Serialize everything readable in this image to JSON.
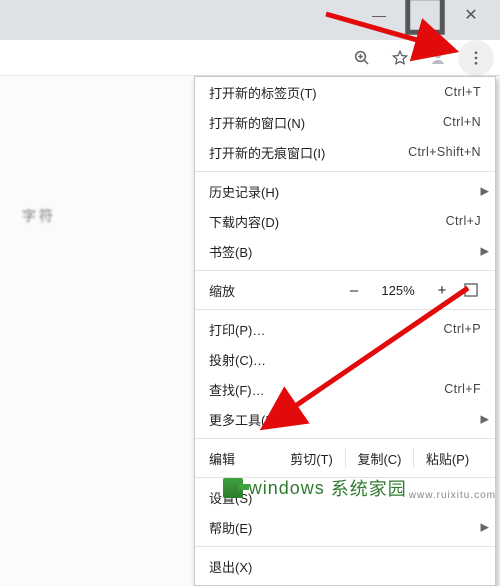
{
  "window_controls": {
    "minimize_glyph": "—",
    "maximize_glyph": "◻",
    "close_glyph": "✕"
  },
  "toolbar": {
    "zoom_icon": "zoom",
    "star_icon": "star",
    "profile_icon": "profile",
    "kebab_icon": "kebab"
  },
  "blur_left_text": "字符",
  "menu": {
    "new_tab": {
      "label": "打开新的标签页(T)",
      "accel": "Ctrl+T"
    },
    "new_window": {
      "label": "打开新的窗口(N)",
      "accel": "Ctrl+N"
    },
    "incognito": {
      "label": "打开新的无痕窗口(I)",
      "accel": "Ctrl+Shift+N"
    },
    "history": {
      "label": "历史记录(H)"
    },
    "downloads": {
      "label": "下载内容(D)",
      "accel": "Ctrl+J"
    },
    "bookmarks": {
      "label": "书签(B)"
    },
    "zoom": {
      "label": "缩放",
      "minus": "–",
      "value": "125%",
      "plus": "+"
    },
    "print": {
      "label": "打印(P)…",
      "accel": "Ctrl+P"
    },
    "cast": {
      "label": "投射(C)…"
    },
    "find": {
      "label": "查找(F)…",
      "accel": "Ctrl+F"
    },
    "more_tools": {
      "label": "更多工具(L)"
    },
    "edit": {
      "label": "编辑",
      "cut": "剪切(T)",
      "copy": "复制(C)",
      "paste": "粘贴(P)"
    },
    "settings": {
      "label": "设置(S)"
    },
    "help": {
      "label": "帮助(E)"
    },
    "exit": {
      "label": "退出(X)"
    }
  },
  "watermark": {
    "main": "windows",
    "tail": "系统家园",
    "url": "www.ruixitu.com"
  },
  "colors": {
    "arrow": "#e20a0a"
  }
}
